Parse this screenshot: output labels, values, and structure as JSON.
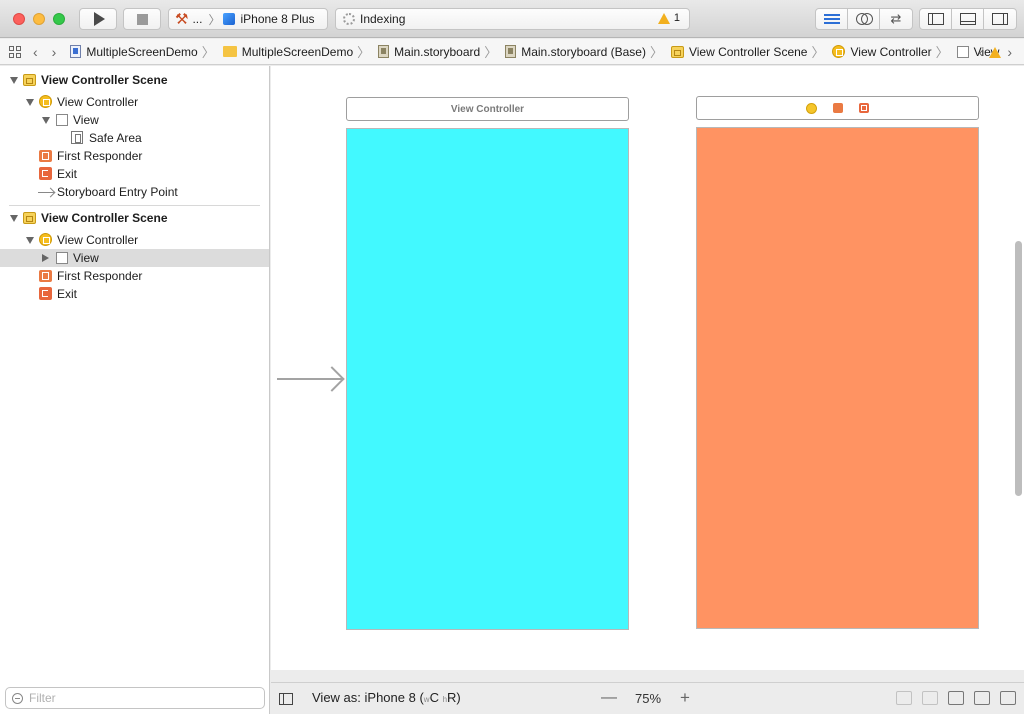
{
  "toolbar": {
    "scheme": {
      "target_short": "...",
      "separator": "〉",
      "device": "iPhone 8 Plus"
    },
    "activity": {
      "status": "Indexing",
      "warning_count": "1"
    },
    "icons": [
      "play-icon",
      "stop-icon",
      "standard-editor-icon",
      "assistant-editor-icon",
      "version-editor-icon",
      "navigator-pane-icon",
      "debug-pane-icon",
      "utilities-pane-icon"
    ]
  },
  "jumpbar": {
    "crumbs": [
      {
        "label": "MultipleScreenDemo",
        "icon": "project-file-icon"
      },
      {
        "label": "MultipleScreenDemo",
        "icon": "folder-icon"
      },
      {
        "label": "Main.storyboard",
        "icon": "storyboard-file-icon"
      },
      {
        "label": "Main.storyboard (Base)",
        "icon": "storyboard-file-icon"
      },
      {
        "label": "View Controller Scene",
        "icon": "scene-icon"
      },
      {
        "label": "View Controller",
        "icon": "view-controller-icon"
      },
      {
        "label": "View",
        "icon": "view-icon"
      }
    ]
  },
  "outline": {
    "scene1": {
      "title": "View Controller Scene",
      "vc": "View Controller",
      "view": "View",
      "safe_area": "Safe Area",
      "first_responder": "First Responder",
      "exit": "Exit",
      "entry_point": "Storyboard Entry Point"
    },
    "scene2": {
      "title": "View Controller Scene",
      "vc": "View Controller",
      "view": "View",
      "first_responder": "First Responder",
      "exit": "Exit"
    },
    "filter_placeholder": "Filter"
  },
  "canvas": {
    "scene1_bar_title": "View Controller",
    "colors": {
      "screen1": "#42f9ff",
      "screen2": "#ff9362"
    }
  },
  "bottom": {
    "view_as_prefix": "View as: iPhone 8 (",
    "size_w": "w",
    "size_c": "C ",
    "size_h": "h",
    "size_r": "R)",
    "zoom": "75%",
    "zoom_minus": "—",
    "zoom_plus": "+"
  }
}
